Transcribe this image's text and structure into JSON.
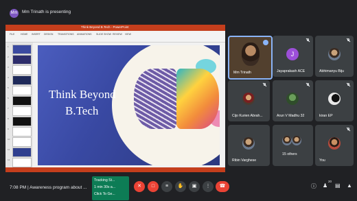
{
  "presenter": {
    "avatar_initials": "Mm",
    "text": "Mm Trinath is presenting"
  },
  "presentation": {
    "window_title": "Think Beyond B.Tech - PowerPoint",
    "ribbon_tabs": [
      "FILE",
      "HOME",
      "INSERT",
      "DESIGN",
      "TRANSITIONS",
      "ANIMATIONS",
      "SLIDE SHOW",
      "REVIEW",
      "VIEW"
    ],
    "slide_title_line1": "Think Beyond",
    "slide_title_line2": "B.Tech",
    "thumb_numbers": [
      "1",
      "2",
      "3",
      "4",
      "5",
      "6",
      "7",
      "8",
      "9",
      "10",
      "11",
      "12"
    ]
  },
  "participants": [
    {
      "name": "Mm Trinath",
      "muted": false,
      "pinned": true
    },
    {
      "name": "Jayaprakash ACE",
      "initial": "J",
      "muted": true
    },
    {
      "name": "Abhimanyu Biju",
      "muted": true
    },
    {
      "name": "Cijo Kurien Abrah...",
      "muted": true
    },
    {
      "name": "Arun V Madhu 32",
      "muted": true
    },
    {
      "name": "kiran EP",
      "muted": true
    },
    {
      "name": "Ribin Varghese",
      "muted": false
    },
    {
      "name": "15 others",
      "muted": false
    },
    {
      "name": "You",
      "muted": true
    }
  ],
  "bottom_bar": {
    "time_meeting": "7:08 PM  |  Awareness program about ...",
    "tracking_lines": [
      "Tracking St...",
      "1 min 30s a...",
      "Click To Ge..."
    ],
    "controls": [
      {
        "name": "mic-off-icon",
        "glyph": "✕"
      },
      {
        "name": "camera-off-icon",
        "glyph": "□"
      },
      {
        "name": "captions-icon",
        "glyph": "≡"
      },
      {
        "name": "raise-hand-icon",
        "glyph": "✋"
      },
      {
        "name": "present-icon",
        "glyph": "▣"
      },
      {
        "name": "more-options-icon",
        "glyph": "⋮"
      },
      {
        "name": "end-call-icon",
        "glyph": "☎"
      }
    ],
    "people_count": "20"
  },
  "colors": {
    "background": "#202124",
    "tile": "#3c4043",
    "accent": "#8ab4f8",
    "red": "#ea4335",
    "green": "#0d7c55",
    "powerpoint": "#c43e1c"
  }
}
